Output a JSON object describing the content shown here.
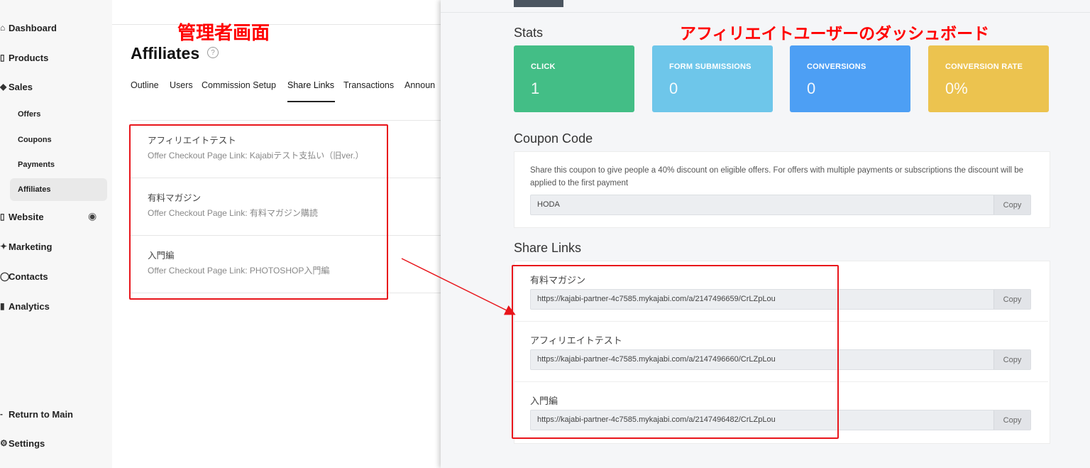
{
  "sidebar": {
    "items": [
      {
        "label": "Dashboard",
        "icon": "home-icon"
      },
      {
        "label": "Products",
        "icon": "box-icon"
      },
      {
        "label": "Sales",
        "icon": "tag-icon"
      },
      {
        "label": "Website",
        "icon": "monitor-icon"
      },
      {
        "label": "Marketing",
        "icon": "megaphone-icon"
      },
      {
        "label": "Contacts",
        "icon": "person-icon"
      },
      {
        "label": "Analytics",
        "icon": "chart-icon"
      }
    ],
    "sales_sub": [
      "Offers",
      "Coupons",
      "Payments",
      "Affiliates"
    ],
    "bottom": [
      {
        "label": "Return to Main",
        "icon": "arrow-left-icon"
      },
      {
        "label": "Settings",
        "icon": "gear-icon"
      }
    ]
  },
  "admin": {
    "annotation": "管理者画面",
    "title": "Affiliates",
    "tabs": [
      "Outline",
      "Users",
      "Commission Setup",
      "Share Links",
      "Transactions",
      "Announ"
    ],
    "active_tab": "Share Links",
    "links": [
      {
        "title": "アフィリエイトテスト",
        "subtitle": "Offer Checkout Page Link: Kajabiテスト支払い（旧ver.）"
      },
      {
        "title": "有料マガジン",
        "subtitle": "Offer Checkout Page Link: 有料マガジン購読"
      },
      {
        "title": "入門編",
        "subtitle": "Offer Checkout Page Link: PHOTOSHOP入門編"
      }
    ]
  },
  "dashboard": {
    "annotation": "アフィリエイトユーザーのダッシュボード",
    "stats_heading": "Stats",
    "stats": [
      {
        "label": "CLICK",
        "value": "1",
        "color": "#43be86"
      },
      {
        "label": "FORM SUBMISSIONS",
        "value": "0",
        "color": "#6ec6ea"
      },
      {
        "label": "CONVERSIONS",
        "value": "0",
        "color": "#4d9ff4"
      },
      {
        "label": "CONVERSION RATE",
        "value": "0%",
        "color": "#ecc34f"
      }
    ],
    "coupon_heading": "Coupon Code",
    "coupon_text": "Share this coupon to give people a 40% discount on eligible offers. For offers with multiple payments or subscriptions the discount will be applied to the first payment",
    "coupon_code": "HODA",
    "copy_label": "Copy",
    "share_heading": "Share Links",
    "share_links": [
      {
        "title": "有料マガジン",
        "url": "https://kajabi-partner-4c7585.mykajabi.com/a/2147496659/CrLZpLou"
      },
      {
        "title": "アフィリエイトテスト",
        "url": "https://kajabi-partner-4c7585.mykajabi.com/a/2147496660/CrLZpLou"
      },
      {
        "title": "入門編",
        "url": "https://kajabi-partner-4c7585.mykajabi.com/a/2147496482/CrLZpLou"
      }
    ]
  },
  "colors": {
    "annotation_red": "#e8151b"
  }
}
